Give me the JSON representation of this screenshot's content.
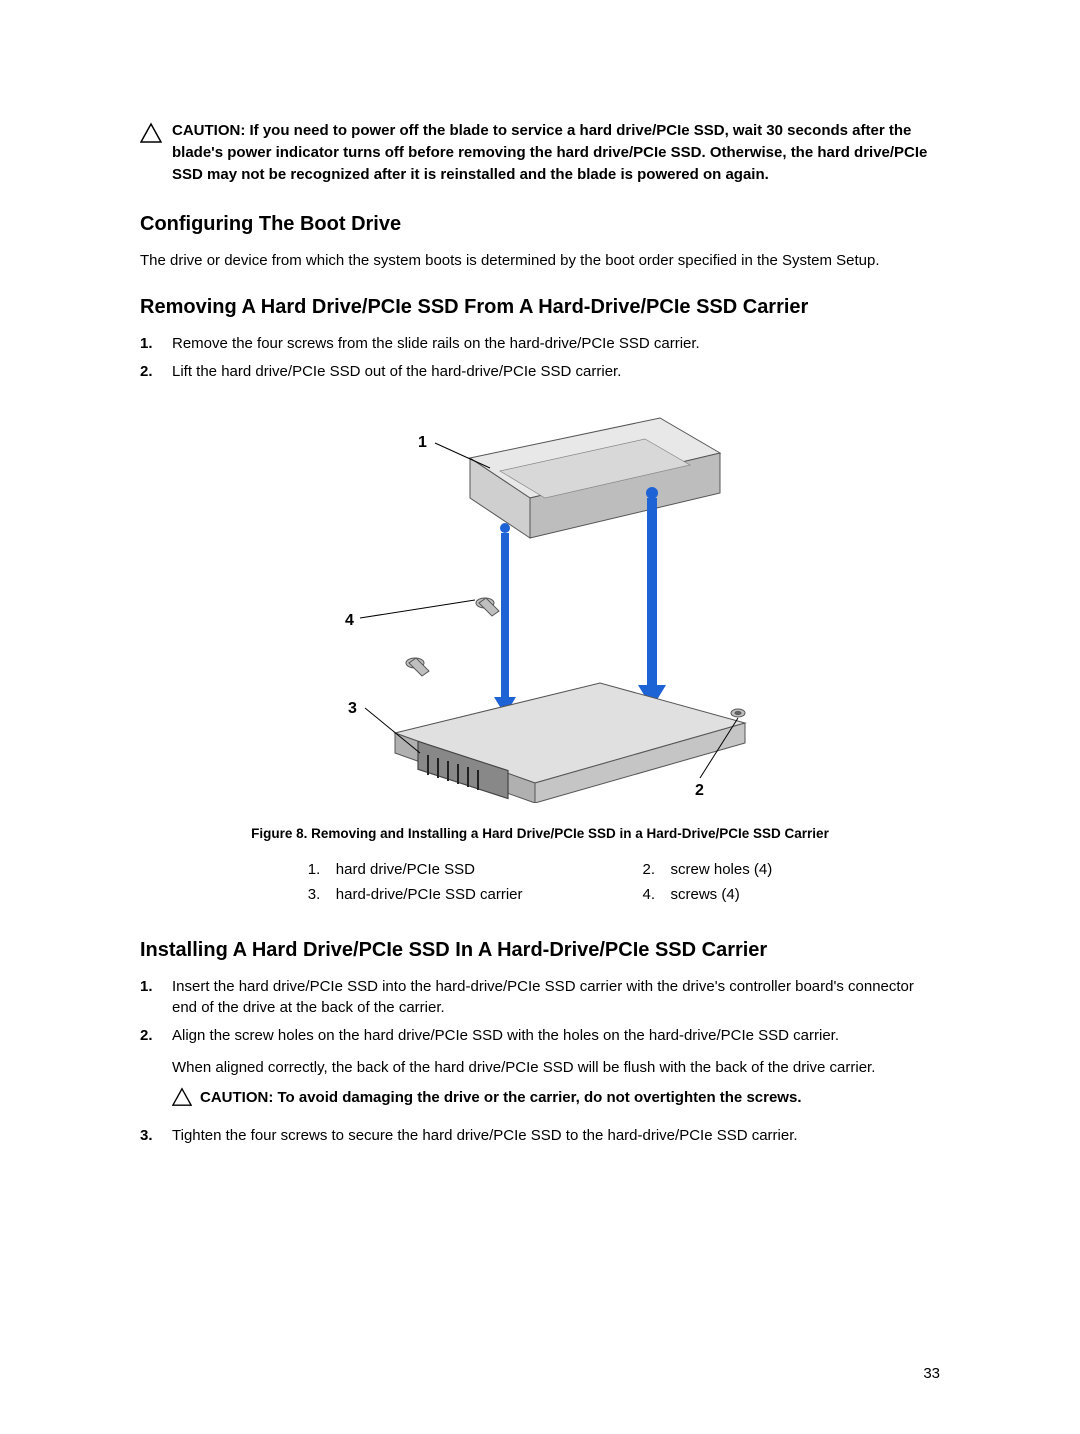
{
  "caution1": "CAUTION: If you need to power off the blade to service a hard drive/PCIe SSD, wait 30 seconds after the blade's power indicator turns off before removing the hard drive/PCIe SSD. Otherwise, the hard drive/PCIe SSD may not be recognized after it is reinstalled and the blade is powered on again.",
  "h_boot": "Configuring The Boot Drive",
  "p_boot": "The drive or device from which the system boots is determined by the boot order specified in the System Setup.",
  "h_remove": "Removing A Hard Drive/PCIe SSD From A Hard-Drive/PCIe SSD Carrier",
  "remove_steps": [
    "Remove the four screws from the slide rails on the hard-drive/PCIe SSD carrier.",
    "Lift the hard drive/PCIe SSD out of the hard-drive/PCIe SSD carrier."
  ],
  "fig_caption": "Figure 8. Removing and Installing a Hard Drive/PCIe SSD in a Hard-Drive/PCIe SSD Carrier",
  "legend": {
    "1": "hard drive/PCIe SSD",
    "2": "screw holes (4)",
    "3": "hard-drive/PCIe SSD carrier",
    "4": "screws (4)"
  },
  "h_install": "Installing A Hard Drive/PCIe SSD In A Hard-Drive/PCIe SSD Carrier",
  "install_steps": [
    "Insert the hard drive/PCIe SSD into the hard-drive/PCIe SSD carrier with the drive's controller board's connector end of the drive at the back of the carrier.",
    "Align the screw holes on the hard drive/PCIe SSD with the holes on the hard-drive/PCIe SSD carrier.",
    "Tighten the four screws to secure the hard drive/PCIe SSD to the hard-drive/PCIe SSD carrier."
  ],
  "install_step2_note": "When aligned correctly, the back of the hard drive/PCIe SSD will be flush with the back of the drive carrier.",
  "install_caution": "CAUTION: To avoid damaging the drive or the carrier, do not overtighten the screws.",
  "fig_labels": {
    "1": "1",
    "2": "2",
    "3": "3",
    "4": "4"
  },
  "page_number": "33"
}
